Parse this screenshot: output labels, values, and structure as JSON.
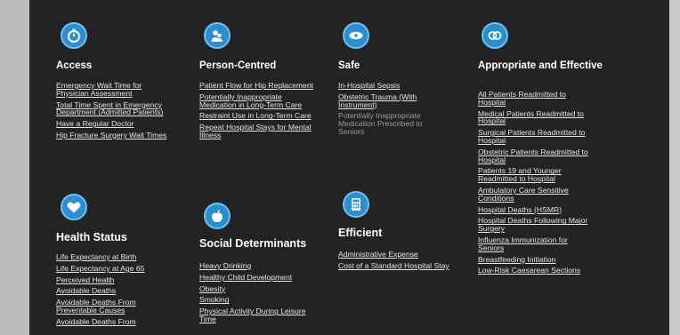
{
  "sections": {
    "access": {
      "title": "Access",
      "icon": "stopwatch-icon",
      "links": [
        "Emergency Wait Time for Physician Assessment",
        "Total Time Spent in Emergency Department (Admitted Patients)",
        "Have a Regular Doctor",
        "Hip Fracture Surgery Wait Times"
      ]
    },
    "person_centred": {
      "title": "Person-Centred",
      "icon": "people-icon",
      "links": [
        "Patient Flow for Hip Replacement",
        "Potentially Inappropriate Medication in Long-Term Care",
        "Restraint Use in Long-Term Care",
        "Repeat Hospital Stays for Mental Illness"
      ]
    },
    "safe": {
      "title": "Safe",
      "icon": "bandage-icon",
      "links": [
        "In-Hospital Sepsis",
        "Obstetric Trauma (With Instrument)"
      ],
      "note": "Potentially Inappropriate Medication Prescribed to Seniors"
    },
    "appropriate": {
      "title": "Appropriate and Effective",
      "icon": "rings-icon",
      "links": [
        "All Patients Readmitted to Hospital",
        "Medical Patients Readmitted to Hospital",
        "Surgical Patients Readmitted to Hospital",
        "Obstetric Patients Readmitted to Hospital",
        "Patients 19 and Younger Readmitted to Hospital",
        "Ambulatory Care Sensitive Conditions",
        "Hospital Deaths (HSMR)",
        "Hospital Deaths Following Major Surgery",
        "Influenza Immunization for Seniors",
        "Breastfeeding Initiation",
        "Low-Risk Caesarean Sections"
      ]
    },
    "health_status": {
      "title": "Health Status",
      "icon": "heart-icon",
      "links": [
        "Life Expectancy at Birth",
        "Life Expectancy at Age 65",
        "Perceived Health",
        "Avoidable Deaths",
        "Avoidable Deaths From Preventable Causes",
        "Avoidable Deaths From"
      ]
    },
    "social": {
      "title": "Social Determinants",
      "icon": "apple-icon",
      "links": [
        "Heavy Drinking",
        "Healthy Child Development",
        "Obesity",
        "Smoking",
        "Physical Activity During Leisure Time"
      ]
    },
    "efficient": {
      "title": "Efficient",
      "icon": "calculator-icon",
      "links": [
        "Administrative Expense",
        "Cost of a Standard Hospital Stay"
      ]
    }
  }
}
